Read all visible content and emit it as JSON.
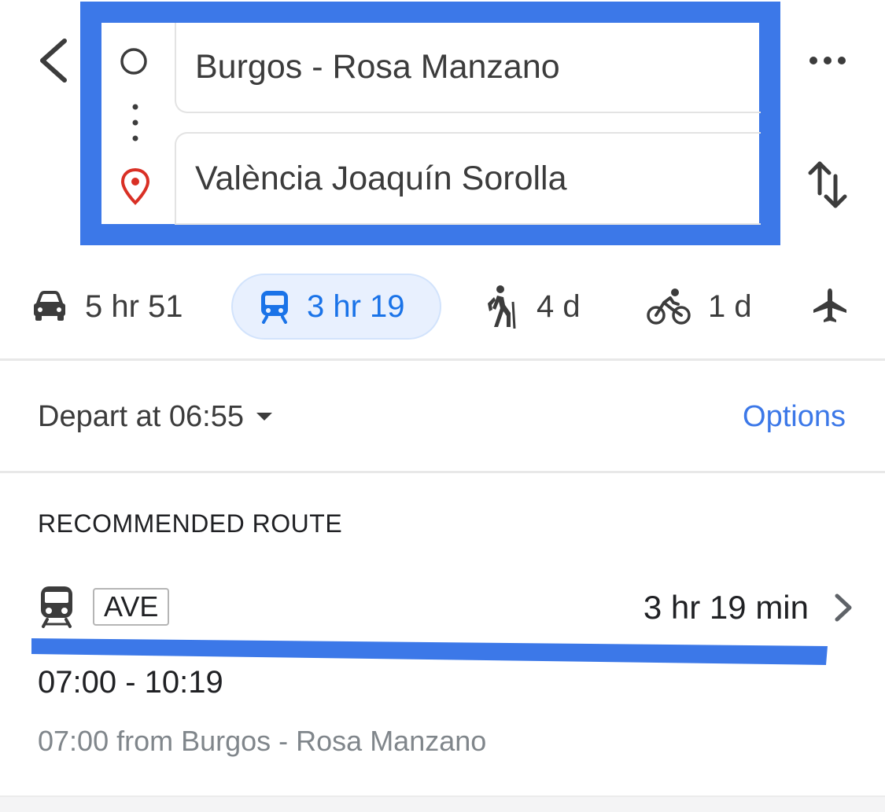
{
  "header": {
    "origin": "Burgos - Rosa Manzano",
    "destination": "València Joaquín Sorolla",
    "back_icon": "chevron-left-icon",
    "more_icon": "more-horizontal-icon",
    "swap_icon": "swap-vertical-icon"
  },
  "modes": [
    {
      "name": "drive",
      "icon": "car-icon",
      "label": "5 hr 51"
    },
    {
      "name": "transit",
      "icon": "train-icon",
      "label": "3 hr 19",
      "selected": true
    },
    {
      "name": "walk",
      "icon": "hiking-icon",
      "label": "4 d"
    },
    {
      "name": "bike",
      "icon": "bicycle-icon",
      "label": "1 d"
    },
    {
      "name": "flight",
      "icon": "airplane-icon",
      "label": ""
    }
  ],
  "depart": {
    "label": "Depart at 06:55",
    "options_label": "Options"
  },
  "route": {
    "section_title": "RECOMMENDED ROUTE",
    "line_badge": "AVE",
    "duration": "3 hr 19 min",
    "time_range": "07:00 - 10:19",
    "from_text": "07:00 from Burgos - Rosa Manzano"
  },
  "colors": {
    "annotation_blue": "#3c78e8",
    "accent_blue": "#1a73e8",
    "pin_red": "#d93025",
    "selected_bg": "#e8f0fe"
  }
}
